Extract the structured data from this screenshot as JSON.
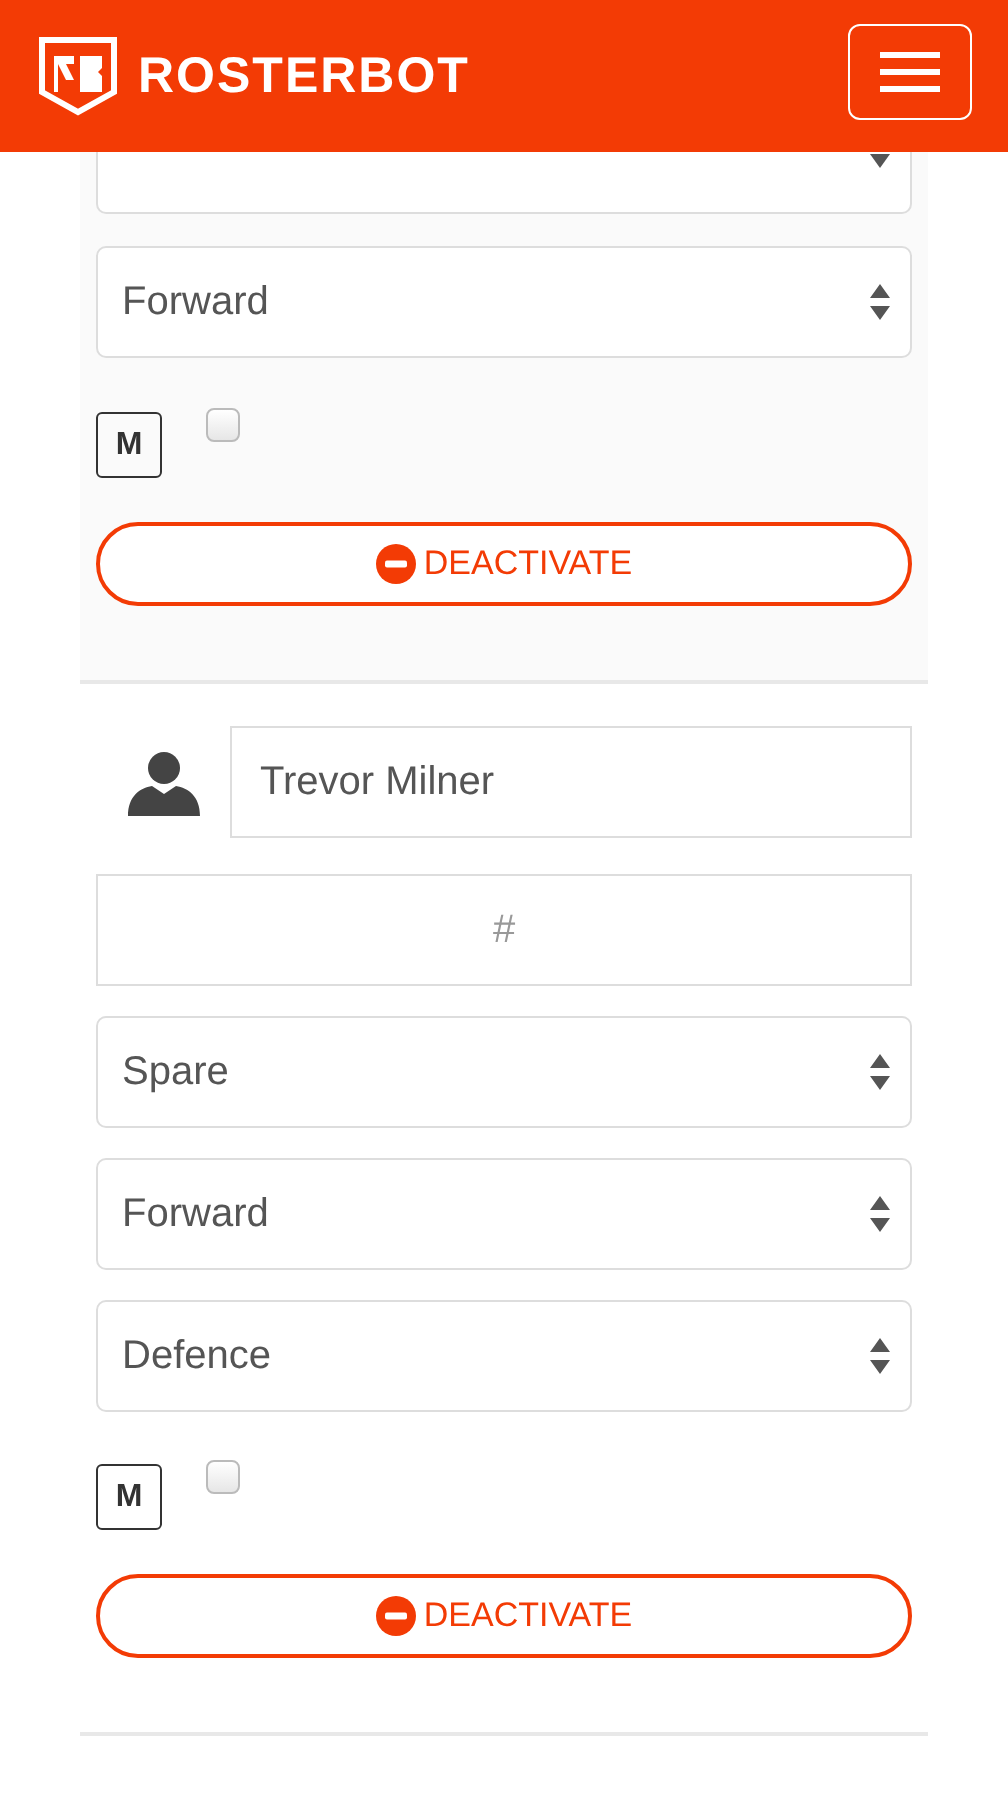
{
  "header": {
    "brand": "ROSTERBOT"
  },
  "players": [
    {
      "positions": [
        {
          "kind": "cut"
        },
        {
          "kind": "full",
          "value": "Forward"
        }
      ],
      "badge": "M",
      "checked": false,
      "button": "DEACTIVATE"
    },
    {
      "name": "Trevor Milner",
      "number_placeholder": "#",
      "positions": [
        {
          "kind": "full",
          "value": "Spare"
        },
        {
          "kind": "full",
          "value": "Forward"
        },
        {
          "kind": "full",
          "value": "Defence"
        }
      ],
      "badge": "M",
      "checked": false,
      "button": "DEACTIVATE"
    }
  ]
}
